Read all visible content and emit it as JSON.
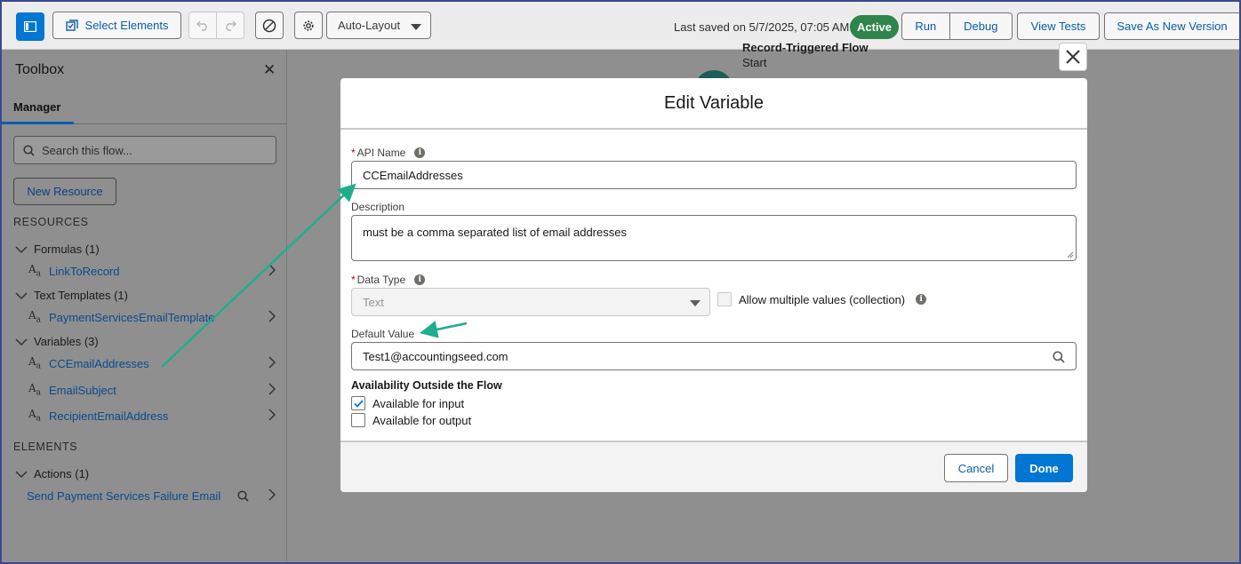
{
  "toolbar": {
    "select_elements_label": "Select Elements",
    "layout_label": "Auto-Layout",
    "last_saved": "Last saved on 5/7/2025, 07:05 AM",
    "status_badge": "Active",
    "run_label": "Run",
    "debug_label": "Debug",
    "view_tests_label": "View Tests",
    "save_new_version_label": "Save As New Version"
  },
  "sidebar": {
    "title": "Toolbox",
    "tab_manager": "Manager",
    "search_placeholder": "Search this flow...",
    "new_resource_label": "New Resource",
    "resources_heading": "RESOURCES",
    "elements_heading": "ELEMENTS",
    "groups": [
      {
        "label": "Formulas (1)",
        "items": [
          "LinkToRecord"
        ]
      },
      {
        "label": "Text Templates (1)",
        "items": [
          "PaymentServicesEmailTemplate"
        ]
      },
      {
        "label": "Variables (3)",
        "items": [
          "CCEmailAddresses",
          "EmailSubject",
          "RecipientEmailAddress"
        ]
      },
      {
        "label": "Actions (1)",
        "items": [
          "Send Payment Services Failure Email"
        ]
      }
    ]
  },
  "canvas": {
    "node_title": "Record-Triggered Flow",
    "node_subtitle": "Start"
  },
  "modal": {
    "title": "Edit Variable",
    "api_name_label": "API Name",
    "api_name_value": "CCEmailAddresses",
    "description_label": "Description",
    "description_value": "must be a comma separated list of email addresses",
    "data_type_label": "Data Type",
    "data_type_value": "Text",
    "allow_multiple_label": "Allow multiple values (collection)",
    "default_value_label": "Default Value",
    "default_value_value": "Test1@accountingseed.com",
    "availability_heading": "Availability Outside the Flow",
    "available_input_label": "Available for input",
    "available_input_checked": true,
    "available_output_label": "Available for output",
    "available_output_checked": false,
    "cancel_label": "Cancel",
    "done_label": "Done"
  },
  "colors": {
    "brand_blue": "#0176d3",
    "active_green": "#2e844a",
    "annotation_arrow": "#1fae8c"
  }
}
